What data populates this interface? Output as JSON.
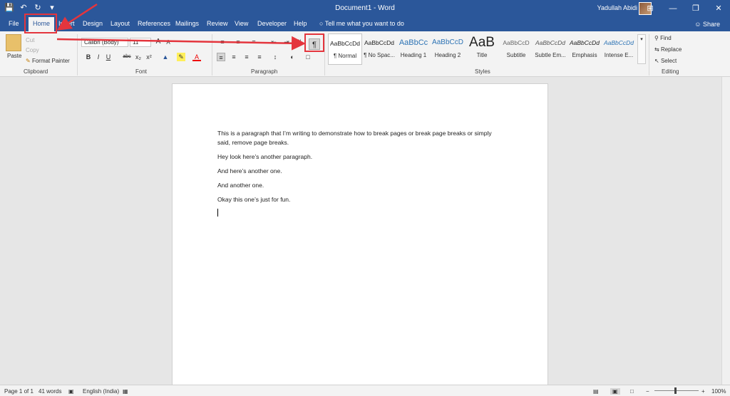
{
  "titlebar": {
    "doc_title": "Document1  -  Word",
    "user": "Yadullah Abidi",
    "minimize": "—",
    "restore": "❐",
    "close": "✕",
    "ribbon_options": "⊞",
    "save": "💾",
    "undo": "↶",
    "redo": "↻",
    "customize": "▾"
  },
  "tabs": {
    "file": "File",
    "home": "Home",
    "insert": "Insert",
    "design": "Design",
    "layout": "Layout",
    "references": "References",
    "mailings": "Mailings",
    "review": "Review",
    "view": "View",
    "developer": "Developer",
    "help": "Help",
    "tellme": "Tell me what you want to do",
    "share": "Share"
  },
  "clipboard": {
    "paste": "Paste",
    "cut": "Cut",
    "copy": "Copy",
    "format_painter": "Format Painter",
    "label": "Clipboard"
  },
  "font": {
    "name": "Calibri (Body)",
    "size": "11",
    "label": "Font",
    "bold": "B",
    "italic": "I",
    "underline": "U",
    "strike": "abc",
    "subscript": "x₂",
    "superscript": "x²",
    "font_color": "A",
    "grow": "A",
    "shrink": "A"
  },
  "paragraph": {
    "label": "Paragraph",
    "show_hide": "¶"
  },
  "styles": {
    "label": "Styles",
    "items": [
      {
        "sample": "AaBbCcDd",
        "name": "¶ Normal"
      },
      {
        "sample": "AaBbCcDd",
        "name": "¶ No Spac..."
      },
      {
        "sample": "AaBbCc",
        "name": "Heading 1"
      },
      {
        "sample": "AaBbCcD",
        "name": "Heading 2"
      },
      {
        "sample": "AaB",
        "name": "Title"
      },
      {
        "sample": "AaBbCcD",
        "name": "Subtitle"
      },
      {
        "sample": "AaBbCcDd",
        "name": "Subtle Em..."
      },
      {
        "sample": "AaBbCcDd",
        "name": "Emphasis"
      },
      {
        "sample": "AaBbCcDd",
        "name": "Intense E..."
      }
    ]
  },
  "editing": {
    "find": "Find",
    "replace": "Replace",
    "select": "Select",
    "label": "Editing"
  },
  "document": {
    "paragraphs": [
      "This is a paragraph that I’m writing to demonstrate how to break pages or break page breaks or simply said, remove page breaks.",
      "Hey look here’s another paragraph.",
      "And here’s another one.",
      "And another one.",
      "Okay this one’s just for fun."
    ]
  },
  "status": {
    "page": "Page 1 of 1",
    "words": "41 words",
    "language": "English (India)",
    "zoom": "100%",
    "zoom_minus": "−",
    "zoom_plus": "+"
  },
  "colors": {
    "accent": "#2b579a",
    "annotation": "#e4353d"
  }
}
